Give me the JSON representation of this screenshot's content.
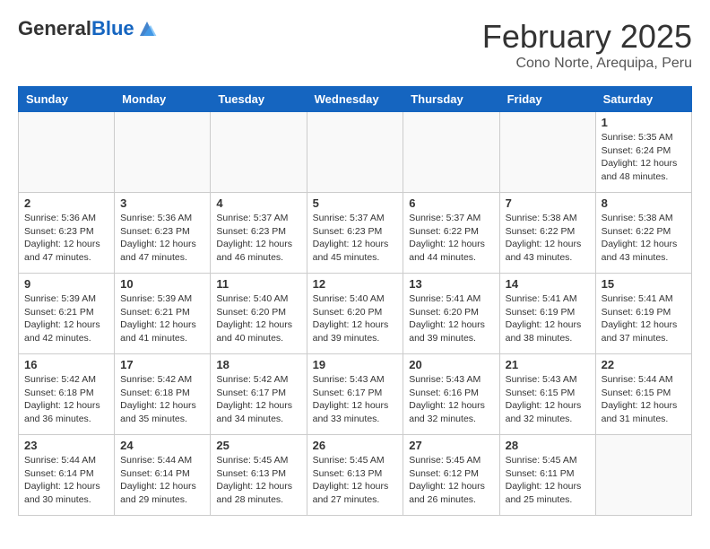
{
  "logo": {
    "general": "General",
    "blue": "Blue"
  },
  "header": {
    "month": "February 2025",
    "location": "Cono Norte, Arequipa, Peru"
  },
  "weekdays": [
    "Sunday",
    "Monday",
    "Tuesday",
    "Wednesday",
    "Thursday",
    "Friday",
    "Saturday"
  ],
  "weeks": [
    [
      {
        "day": "",
        "info": ""
      },
      {
        "day": "",
        "info": ""
      },
      {
        "day": "",
        "info": ""
      },
      {
        "day": "",
        "info": ""
      },
      {
        "day": "",
        "info": ""
      },
      {
        "day": "",
        "info": ""
      },
      {
        "day": "1",
        "info": "Sunrise: 5:35 AM\nSunset: 6:24 PM\nDaylight: 12 hours and 48 minutes."
      }
    ],
    [
      {
        "day": "2",
        "info": "Sunrise: 5:36 AM\nSunset: 6:23 PM\nDaylight: 12 hours and 47 minutes."
      },
      {
        "day": "3",
        "info": "Sunrise: 5:36 AM\nSunset: 6:23 PM\nDaylight: 12 hours and 47 minutes."
      },
      {
        "day": "4",
        "info": "Sunrise: 5:37 AM\nSunset: 6:23 PM\nDaylight: 12 hours and 46 minutes."
      },
      {
        "day": "5",
        "info": "Sunrise: 5:37 AM\nSunset: 6:23 PM\nDaylight: 12 hours and 45 minutes."
      },
      {
        "day": "6",
        "info": "Sunrise: 5:37 AM\nSunset: 6:22 PM\nDaylight: 12 hours and 44 minutes."
      },
      {
        "day": "7",
        "info": "Sunrise: 5:38 AM\nSunset: 6:22 PM\nDaylight: 12 hours and 43 minutes."
      },
      {
        "day": "8",
        "info": "Sunrise: 5:38 AM\nSunset: 6:22 PM\nDaylight: 12 hours and 43 minutes."
      }
    ],
    [
      {
        "day": "9",
        "info": "Sunrise: 5:39 AM\nSunset: 6:21 PM\nDaylight: 12 hours and 42 minutes."
      },
      {
        "day": "10",
        "info": "Sunrise: 5:39 AM\nSunset: 6:21 PM\nDaylight: 12 hours and 41 minutes."
      },
      {
        "day": "11",
        "info": "Sunrise: 5:40 AM\nSunset: 6:20 PM\nDaylight: 12 hours and 40 minutes."
      },
      {
        "day": "12",
        "info": "Sunrise: 5:40 AM\nSunset: 6:20 PM\nDaylight: 12 hours and 39 minutes."
      },
      {
        "day": "13",
        "info": "Sunrise: 5:41 AM\nSunset: 6:20 PM\nDaylight: 12 hours and 39 minutes."
      },
      {
        "day": "14",
        "info": "Sunrise: 5:41 AM\nSunset: 6:19 PM\nDaylight: 12 hours and 38 minutes."
      },
      {
        "day": "15",
        "info": "Sunrise: 5:41 AM\nSunset: 6:19 PM\nDaylight: 12 hours and 37 minutes."
      }
    ],
    [
      {
        "day": "16",
        "info": "Sunrise: 5:42 AM\nSunset: 6:18 PM\nDaylight: 12 hours and 36 minutes."
      },
      {
        "day": "17",
        "info": "Sunrise: 5:42 AM\nSunset: 6:18 PM\nDaylight: 12 hours and 35 minutes."
      },
      {
        "day": "18",
        "info": "Sunrise: 5:42 AM\nSunset: 6:17 PM\nDaylight: 12 hours and 34 minutes."
      },
      {
        "day": "19",
        "info": "Sunrise: 5:43 AM\nSunset: 6:17 PM\nDaylight: 12 hours and 33 minutes."
      },
      {
        "day": "20",
        "info": "Sunrise: 5:43 AM\nSunset: 6:16 PM\nDaylight: 12 hours and 32 minutes."
      },
      {
        "day": "21",
        "info": "Sunrise: 5:43 AM\nSunset: 6:15 PM\nDaylight: 12 hours and 32 minutes."
      },
      {
        "day": "22",
        "info": "Sunrise: 5:44 AM\nSunset: 6:15 PM\nDaylight: 12 hours and 31 minutes."
      }
    ],
    [
      {
        "day": "23",
        "info": "Sunrise: 5:44 AM\nSunset: 6:14 PM\nDaylight: 12 hours and 30 minutes."
      },
      {
        "day": "24",
        "info": "Sunrise: 5:44 AM\nSunset: 6:14 PM\nDaylight: 12 hours and 29 minutes."
      },
      {
        "day": "25",
        "info": "Sunrise: 5:45 AM\nSunset: 6:13 PM\nDaylight: 12 hours and 28 minutes."
      },
      {
        "day": "26",
        "info": "Sunrise: 5:45 AM\nSunset: 6:13 PM\nDaylight: 12 hours and 27 minutes."
      },
      {
        "day": "27",
        "info": "Sunrise: 5:45 AM\nSunset: 6:12 PM\nDaylight: 12 hours and 26 minutes."
      },
      {
        "day": "28",
        "info": "Sunrise: 5:45 AM\nSunset: 6:11 PM\nDaylight: 12 hours and 25 minutes."
      },
      {
        "day": "",
        "info": ""
      }
    ]
  ]
}
